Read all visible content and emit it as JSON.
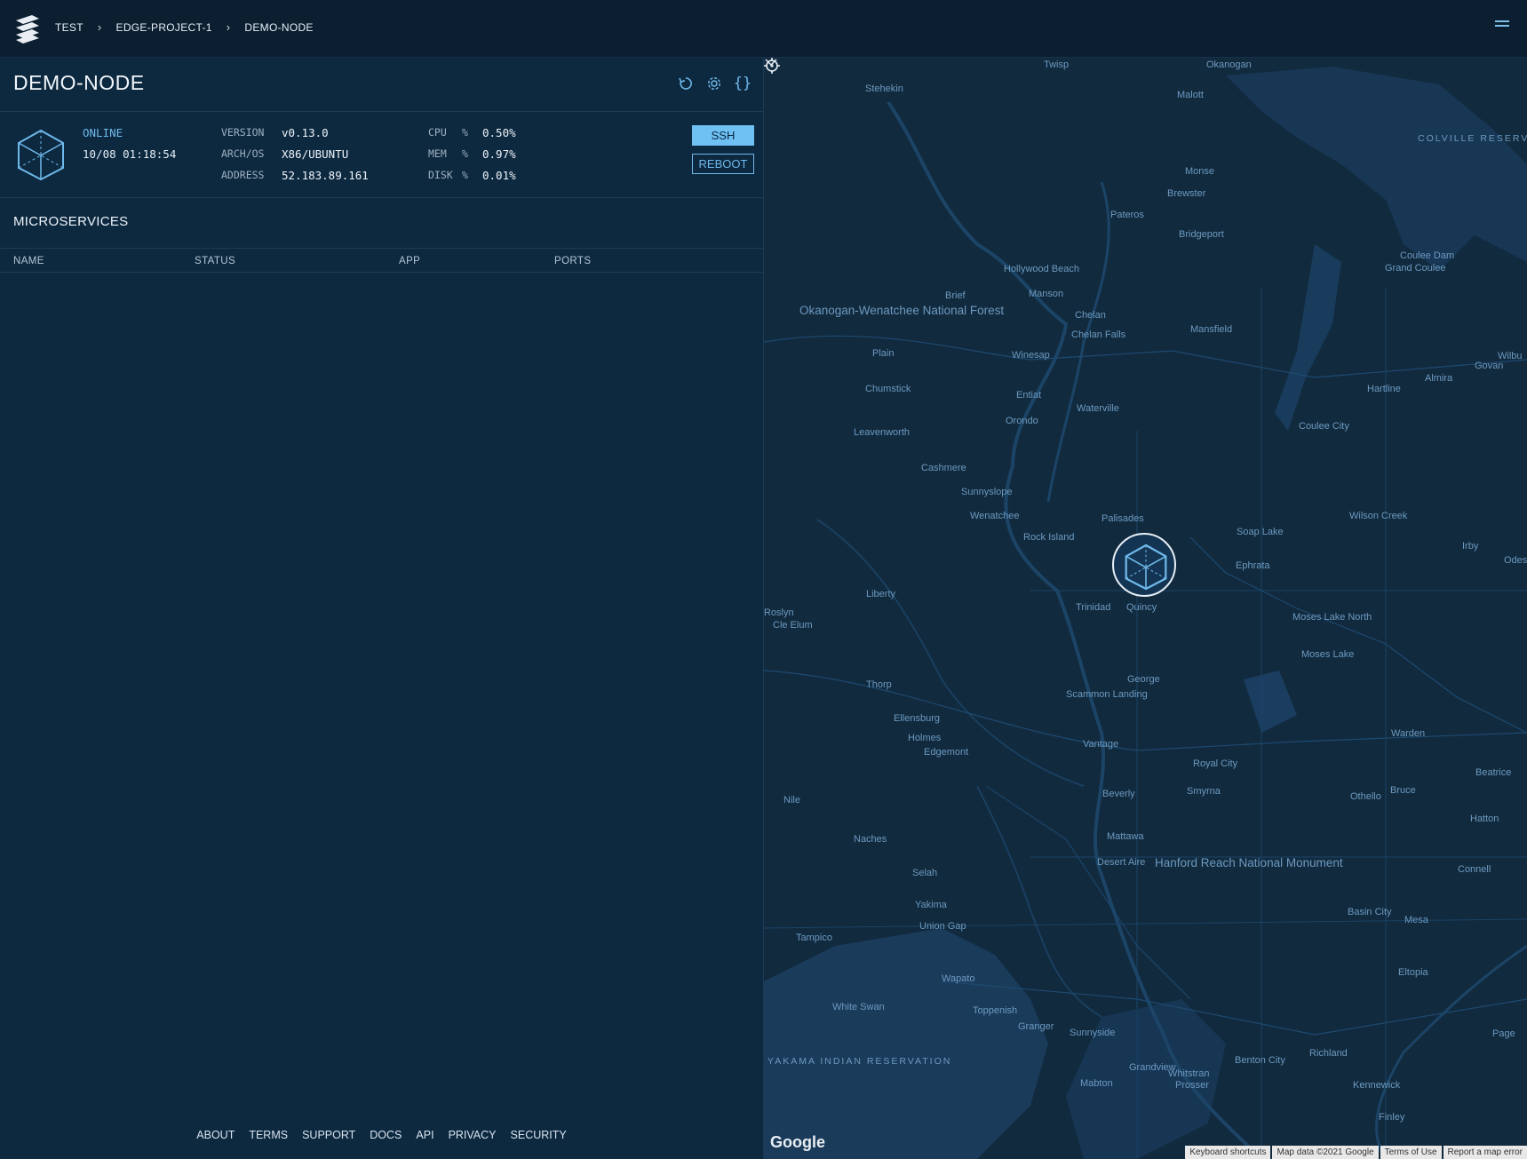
{
  "breadcrumb": {
    "items": [
      "TEST",
      "EDGE-PROJECT-1",
      "DEMO-NODE"
    ],
    "separator": "›"
  },
  "node": {
    "title": "DEMO-NODE",
    "status": "ONLINE",
    "status_time": "10/08 01:18:54",
    "version_label": "VERSION",
    "version": "v0.13.0",
    "arch_label": "ARCH/OS",
    "arch": "X86/UBUNTU",
    "address_label": "ADDRESS",
    "address": "52.183.89.161",
    "cpu_label": "CPU",
    "cpu": "0.50%",
    "mem_label": "MEM",
    "mem": "0.97%",
    "disk_label": "DISK",
    "disk": "0.01%",
    "pct": "%",
    "ssh_label": "SSH",
    "reboot_label": "REBOOT"
  },
  "microservices": {
    "title": "MICROSERVICES",
    "columns": [
      "NAME",
      "STATUS",
      "APP",
      "PORTS"
    ],
    "rows": []
  },
  "footer": {
    "links": [
      "ABOUT",
      "TERMS",
      "SUPPORT",
      "DOCS",
      "API",
      "PRIVACY",
      "SECURITY"
    ]
  },
  "map": {
    "labels": [
      "Twisp",
      "Okanogan",
      "Stehekin",
      "Malott",
      "Brewster",
      "Monse",
      "Pateros",
      "Bridgeport",
      "Coulee Dam",
      "Grand Coulee",
      "Hollywood Beach",
      "Manson",
      "Brief",
      "Chelan",
      "Chelan Falls",
      "Mansfield",
      "Plain",
      "Winesap",
      "Chumstick",
      "Entiat",
      "Waterville",
      "Orondo",
      "Leavenworth",
      "Coulee City",
      "Hartline",
      "Almira",
      "Govan",
      "Cashmere",
      "Sunnyslope",
      "Wenatchee",
      "Rock Island",
      "Palisades",
      "Soap Lake",
      "Wilson Creek",
      "Irby",
      "Ephrata",
      "Liberty",
      "Trinidad",
      "Quincy",
      "Roslyn",
      "Cle Elum",
      "Moses Lake North",
      "Moses Lake",
      "Thorp",
      "George",
      "Scammon Landing",
      "Ellensburg",
      "Holmes",
      "Edgemont",
      "Vantage",
      "Warden",
      "Royal City",
      "Smyrna",
      "Nile",
      "Beverly",
      "Othello",
      "Bruce",
      "Beatrice",
      "Hatton",
      "Naches",
      "Mattawa",
      "Desert Aire",
      "Connell",
      "Selah",
      "Yakima",
      "Union Gap",
      "Tampico",
      "Basin City",
      "Mesa",
      "Eltopia",
      "Wapato",
      "White Swan",
      "Toppenish",
      "Granger",
      "Sunnyside",
      "Page",
      "Richland",
      "Benton City",
      "Grandview",
      "Whitstran",
      "Prosser",
      "Kennewick",
      "Mabton",
      "Finley",
      "Odess",
      "Wilbu"
    ],
    "forest_label": "Okanogan-Wenatchee National Forest",
    "colville_label": "COLVILLE RESERVATION",
    "yakama_label": "YAKAMA INDIAN RESERVATION",
    "hanford_label": "Hanford Reach National Monument",
    "google_logo": "Google",
    "attribution": [
      "Keyboard shortcuts",
      "Map data ©2021 Google",
      "Terms of Use",
      "Report a map error"
    ]
  },
  "colors": {
    "accent": "#6fb8ea",
    "panel_bg": "#0d2940",
    "topbar_bg": "#0b1f30",
    "map_bg": "#112a3e"
  },
  "icons": [
    "logo-icon",
    "menu-icon",
    "refresh-icon",
    "gear-icon",
    "braces-icon",
    "node-cube-icon",
    "crosshair-icon",
    "map-pin-cube-icon",
    "chevron-down-icon"
  ]
}
